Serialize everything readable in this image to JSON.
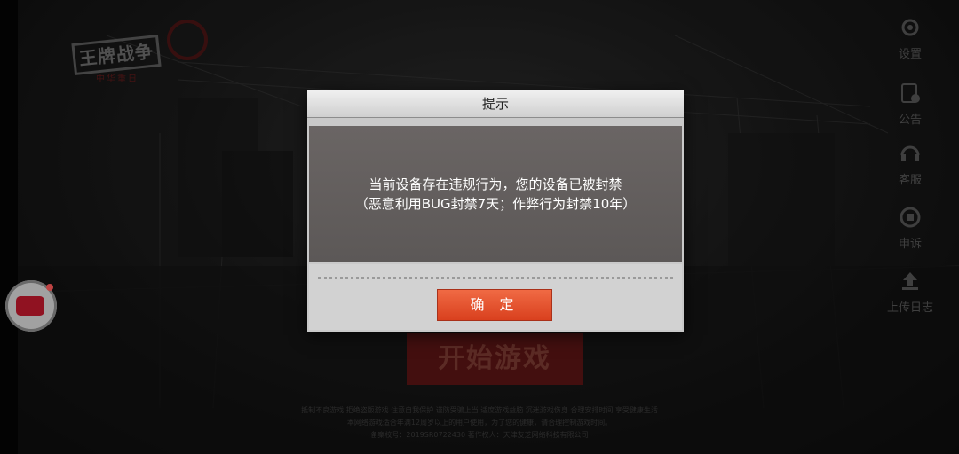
{
  "background": {
    "logo_text": "王牌战争",
    "logo_sub": "中华重日",
    "start_button": "开始游戏",
    "footer_lines": [
      "抵制不良游戏 拒绝盗版游戏 注意自我保护 谨防受骗上当 适度游戏益脑 沉迷游戏伤身 合理安排时间 享受健康生活",
      "本网络游戏适合年满12周岁以上的用户使用，为了您的健康，请合理控制游戏时间。",
      "备案校号：2019SR0722430    著作权人：天津友芝网络科技有限公司"
    ]
  },
  "side_menu": [
    {
      "label": "设置",
      "icon": "gear-icon"
    },
    {
      "label": "公告",
      "icon": "notice-icon"
    },
    {
      "label": "客服",
      "icon": "headset-icon"
    },
    {
      "label": "申诉",
      "icon": "appeal-icon"
    },
    {
      "label": "上传日志",
      "icon": "upload-icon"
    }
  ],
  "dialog": {
    "title": "提示",
    "message_line1": "当前设备存在违规行为，您的设备已被封禁",
    "message_line2": "（恶意利用BUG封禁7天；作弊行为封禁10年）",
    "ok_label": "确 定"
  },
  "colors": {
    "ok_button": "#e5502d",
    "dialog_body": "#625e5d",
    "start_button": "#5a1414"
  }
}
